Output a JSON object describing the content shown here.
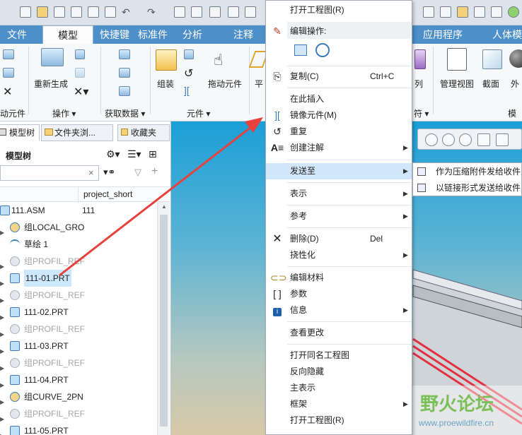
{
  "ribbon_tabs": [
    "文件",
    "模型",
    "快捷键",
    "标准件",
    "分析",
    "注释",
    "应用程序",
    "人体模"
  ],
  "ribbon": {
    "regenerate": "重新生成",
    "assemble": "组装",
    "drag": "拖动元件",
    "plane": "平",
    "mirror_partial": "列",
    "manage_view": "管理视图",
    "section": "截面",
    "appearance": "外",
    "groups": {
      "component_partial": "动元件",
      "operations": "操作",
      "get_data": "获取数据",
      "component": "元件",
      "model_partial": "模",
      "marker_partial": "符"
    }
  },
  "panel": {
    "tabs": [
      "模型树",
      "文件夹浏...",
      "收藏夹"
    ],
    "title": "模型树",
    "column_header": "project_short",
    "search_placeholder": "",
    "search_clear": "×"
  },
  "tree": [
    {
      "label": "111.ASM",
      "value": "111",
      "type": "asm",
      "greyed": false,
      "expander": false
    },
    {
      "label": "组LOCAL_GRO",
      "type": "group",
      "greyed": false,
      "expander": true
    },
    {
      "label": "草绘 1",
      "type": "sketch",
      "greyed": false,
      "expander": false
    },
    {
      "label": "组PROFIL_REF",
      "type": "group",
      "greyed": true,
      "expander": true
    },
    {
      "label": "111-01.PRT",
      "type": "part",
      "greyed": false,
      "expander": true,
      "selected": true
    },
    {
      "label": "组PROFIL_REF",
      "type": "group",
      "greyed": true,
      "expander": true
    },
    {
      "label": "111-02.PRT",
      "type": "part",
      "greyed": false,
      "expander": true
    },
    {
      "label": "组PROFIL_REF",
      "type": "group",
      "greyed": true,
      "expander": true
    },
    {
      "label": "111-03.PRT",
      "type": "part",
      "greyed": false,
      "expander": true
    },
    {
      "label": "组PROFIL_REF",
      "type": "group",
      "greyed": true,
      "expander": true
    },
    {
      "label": "111-04.PRT",
      "type": "part",
      "greyed": false,
      "expander": true
    },
    {
      "label": "组CURVE_2PN",
      "type": "group",
      "greyed": false,
      "expander": true
    },
    {
      "label": "组PROFIL_REF",
      "type": "group",
      "greyed": true,
      "expander": true
    },
    {
      "label": "111-05.PRT",
      "type": "part",
      "greyed": false,
      "expander": true
    }
  ],
  "context_menu": {
    "open_drawing": "打开工程图(R)",
    "edit_ops_header": "编辑操作:",
    "copy": "复制(C)",
    "copy_shortcut": "Ctrl+C",
    "insert_here": "在此插入",
    "mirror_component": "镜像元件(M)",
    "repeat": "重复",
    "create_annotation": "创建注解",
    "send_to": "发送至",
    "display": "表示",
    "reference": "参考",
    "delete": "删除(D)",
    "delete_shortcut": "Del",
    "flexibility": "挠性化",
    "edit_material": "编辑材料",
    "parameters": "参数",
    "info": "信息",
    "view_changes": "查看更改",
    "open_same_name_drawing": "打开同名工程图",
    "invert_hide": "反向隐藏",
    "master_rep": "主表示",
    "frame": "框架",
    "open_drawing_2": "打开工程图(R)"
  },
  "submenu": {
    "as_zip": "作为压缩附件发给收件人",
    "as_link": "以链接形式发送给收件人"
  },
  "watermark": {
    "title": "野火论坛",
    "url": "www.proewildfire.cn"
  },
  "colors": {
    "tabbar": "#4d8fc9",
    "highlight": "#cfe6fb",
    "arrow": "#e8403a",
    "selected": "#cce8ff"
  }
}
